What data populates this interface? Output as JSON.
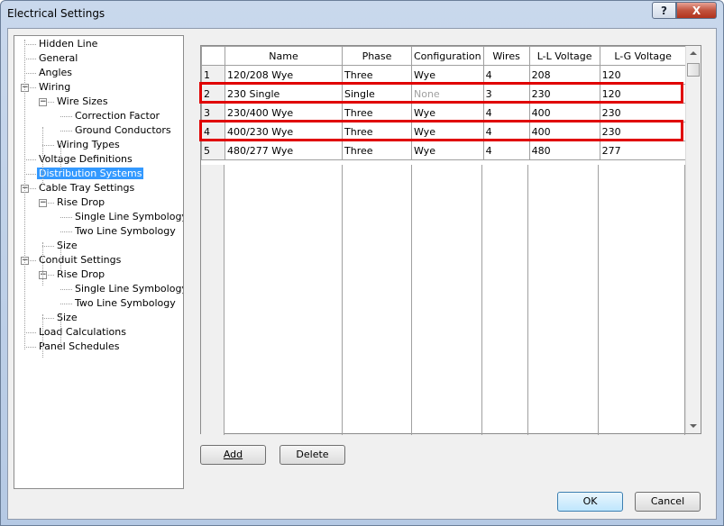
{
  "window": {
    "title": "Electrical Settings",
    "help_glyph": "?",
    "close_glyph": "X"
  },
  "tree": {
    "items": [
      {
        "label": "Hidden Line",
        "level": 1
      },
      {
        "label": "General",
        "level": 1
      },
      {
        "label": "Angles",
        "level": 1
      },
      {
        "label": "Wiring",
        "level": 1,
        "expander": "−"
      },
      {
        "label": "Wire Sizes",
        "level": 2,
        "expander": "−"
      },
      {
        "label": "Correction Factor",
        "level": 3
      },
      {
        "label": "Ground Conductors",
        "level": 3
      },
      {
        "label": "Wiring Types",
        "level": 2
      },
      {
        "label": "Voltage Definitions",
        "level": 1
      },
      {
        "label": "Distribution Systems",
        "level": 1,
        "selected": true
      },
      {
        "label": "Cable Tray Settings",
        "level": 1,
        "expander": "−"
      },
      {
        "label": "Rise Drop",
        "level": 2,
        "expander": "−"
      },
      {
        "label": "Single Line Symbology",
        "level": 3
      },
      {
        "label": "Two Line Symbology",
        "level": 3
      },
      {
        "label": "Size",
        "level": 2
      },
      {
        "label": "Conduit Settings",
        "level": 1,
        "expander": "−"
      },
      {
        "label": "Rise Drop",
        "level": 2,
        "expander": "−"
      },
      {
        "label": "Single Line Symbology",
        "level": 3
      },
      {
        "label": "Two Line Symbology",
        "level": 3
      },
      {
        "label": "Size",
        "level": 2
      },
      {
        "label": "Load Calculations",
        "level": 1
      },
      {
        "label": "Panel Schedules",
        "level": 1
      }
    ]
  },
  "grid": {
    "columns": [
      "Name",
      "Phase",
      "Configuration",
      "Wires",
      "L-L Voltage",
      "L-G Voltage"
    ],
    "rows": [
      {
        "num": "1",
        "name": "120/208 Wye",
        "phase": "Three",
        "config": "Wye",
        "wires": "4",
        "ll": "208",
        "lg": "120",
        "highlight": false
      },
      {
        "num": "2",
        "name": "230 Single",
        "phase": "Single",
        "config": "None",
        "config_dim": true,
        "wires": "3",
        "ll": "230",
        "lg": "120",
        "highlight": true
      },
      {
        "num": "3",
        "name": "230/400 Wye",
        "phase": "Three",
        "config": "Wye",
        "wires": "4",
        "ll": "400",
        "lg": "230",
        "highlight": false
      },
      {
        "num": "4",
        "name": "400/230 Wye",
        "phase": "Three",
        "config": "Wye",
        "wires": "4",
        "ll": "400",
        "lg": "230",
        "highlight": true
      },
      {
        "num": "5",
        "name": "480/277 Wye",
        "phase": "Three",
        "config": "Wye",
        "wires": "4",
        "ll": "480",
        "lg": "277",
        "highlight": false
      }
    ],
    "highlight_color": "#e00000"
  },
  "buttons": {
    "add": "Add",
    "delete": "Delete",
    "ok": "OK",
    "cancel": "Cancel"
  }
}
